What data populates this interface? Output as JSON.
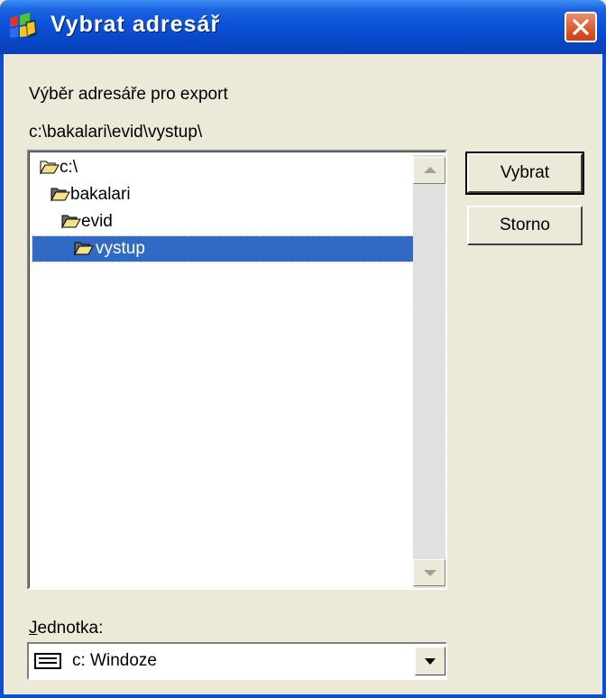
{
  "window": {
    "title": "Vybrat adresář"
  },
  "dialog": {
    "prompt": "Výběr adresáře pro export",
    "current_path": "c:\\bakalari\\evid\\vystup\\"
  },
  "tree": {
    "items": [
      {
        "label": "c:\\",
        "depth": 0,
        "icon": "open-folder-icon",
        "selected": false
      },
      {
        "label": "bakalari",
        "depth": 1,
        "icon": "open-folder-icon",
        "selected": false
      },
      {
        "label": "evid",
        "depth": 2,
        "icon": "open-folder-icon",
        "selected": false
      },
      {
        "label": "vystup",
        "depth": 3,
        "icon": "open-folder-icon",
        "selected": true
      }
    ]
  },
  "buttons": {
    "ok": "Vybrat",
    "cancel": "Storno"
  },
  "drive": {
    "label": "Jednotka:",
    "selected_value": "c: Windoze",
    "icon": "hard-drive-icon"
  },
  "colors": {
    "titlebar": "#0a52d8",
    "selection": "#316ac5",
    "dialog_bg": "#ece9d8",
    "close_button": "#d95a30"
  }
}
